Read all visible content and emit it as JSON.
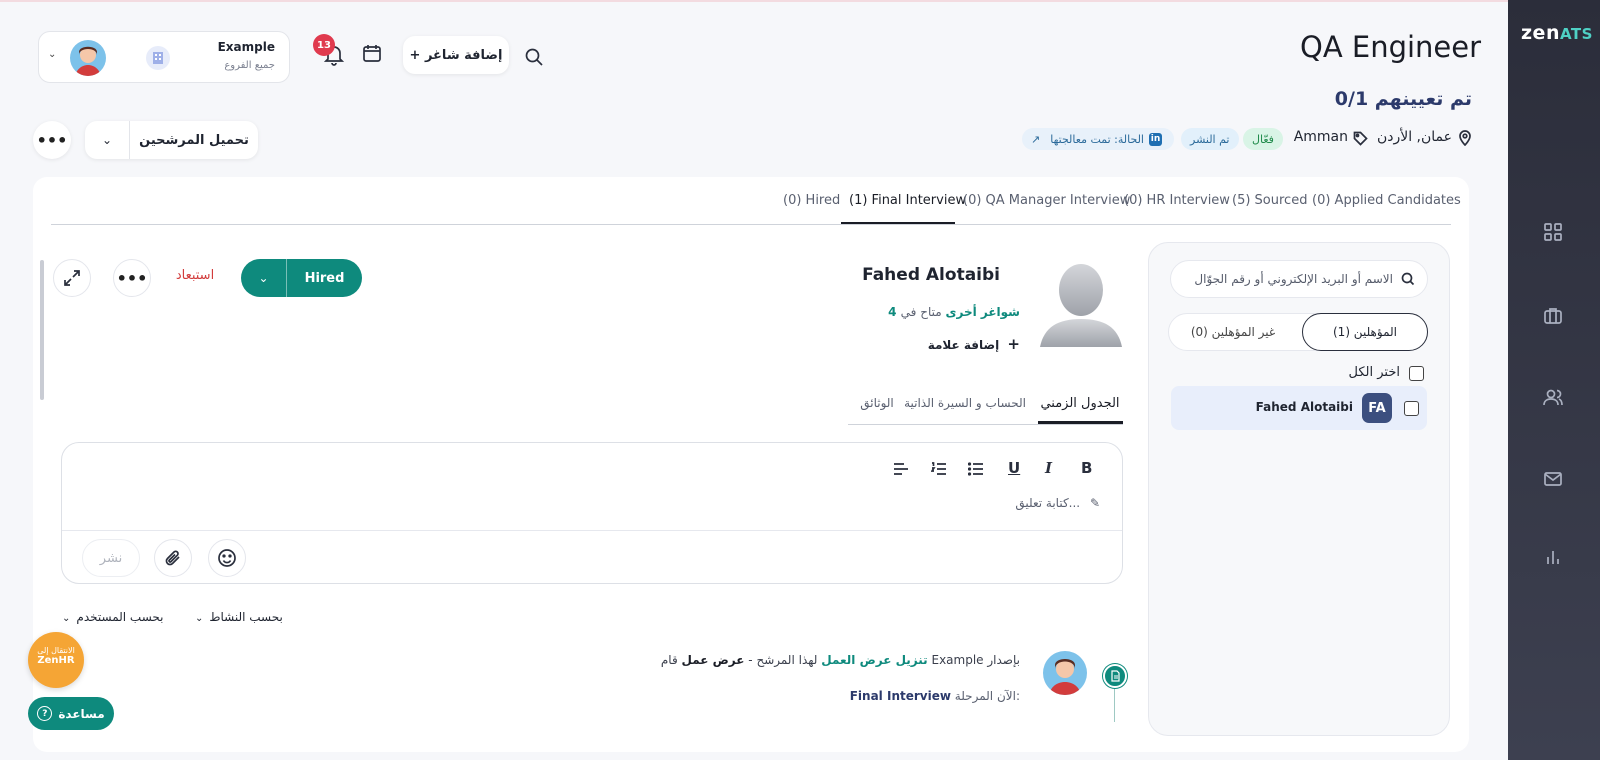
{
  "app": {
    "logo_main": "zen",
    "logo_accent": "ATS"
  },
  "header": {
    "job_title": "QA Engineer",
    "hired_count": "0/1 تم تعيينهم",
    "location": "عمان, الأردن",
    "tag": "Amman",
    "chips": {
      "active": "فعّال",
      "published": "تم النشر",
      "status": "الحالة: تمت معالجتها"
    },
    "add_vacancy": "+ إضافة شاغر",
    "notifications_count": "13",
    "company": {
      "name": "Example",
      "branch": "جميع الفروع"
    },
    "upload_candidates": "تحميل المرشحين"
  },
  "stage_tabs": [
    {
      "label": "(0) Hired"
    },
    {
      "label": "(1) Final Interview"
    },
    {
      "label": "(0) QA Manager Interview"
    },
    {
      "label": "(0) HR Interview"
    },
    {
      "label": "(5) Sourced"
    },
    {
      "label": "(0) Applied Candidates"
    }
  ],
  "candidate_panel": {
    "search_placeholder": "الاسم أو البريد الإلكتروني أو رقم الجوّال",
    "qualified_tab": "المؤهلين (1)",
    "unqualified_tab": "غير المؤهلين (0)",
    "select_all": "اختر الكل",
    "candidates": [
      {
        "initials": "FA",
        "name": "Fahed Alotaibi"
      }
    ]
  },
  "profile": {
    "name": "Fahed Alotaibi",
    "available_prefix": "متاح في",
    "available_link": "4 شواغر أخرى",
    "add_tag": "إضافة علامة",
    "stage_button": "Hired",
    "exclude": "استبعاد",
    "tabs": [
      "الجدول الزمني",
      "الحساب و السيرة الذاتية",
      "الوثائق"
    ]
  },
  "comment": {
    "placeholder": "كتابة تعليق...",
    "publish": "نشر",
    "toolbar": {
      "bold": "B",
      "italic": "I",
      "underline": "U"
    }
  },
  "filters": {
    "by_activity": "بحسب النشاط",
    "by_user": "بحسب المستخدم"
  },
  "activity": {
    "line1_a": "قام Example بإصدار",
    "line1_b": "عرض عمل",
    "line1_c": "لهذا المرشح -",
    "line1_link": "تنزيل عرض العمل",
    "stage_label": "الآن المرحلة:",
    "stage_value": "Final Interview"
  },
  "floating": {
    "zenhr_line1": "الانتقال إلى",
    "zenhr_line2": "ZenHR",
    "help": "مساعدة"
  },
  "colors": {
    "teal": "#0e8a7d",
    "navy": "#2c3a6b",
    "sidebar": "#2b2d3a"
  }
}
